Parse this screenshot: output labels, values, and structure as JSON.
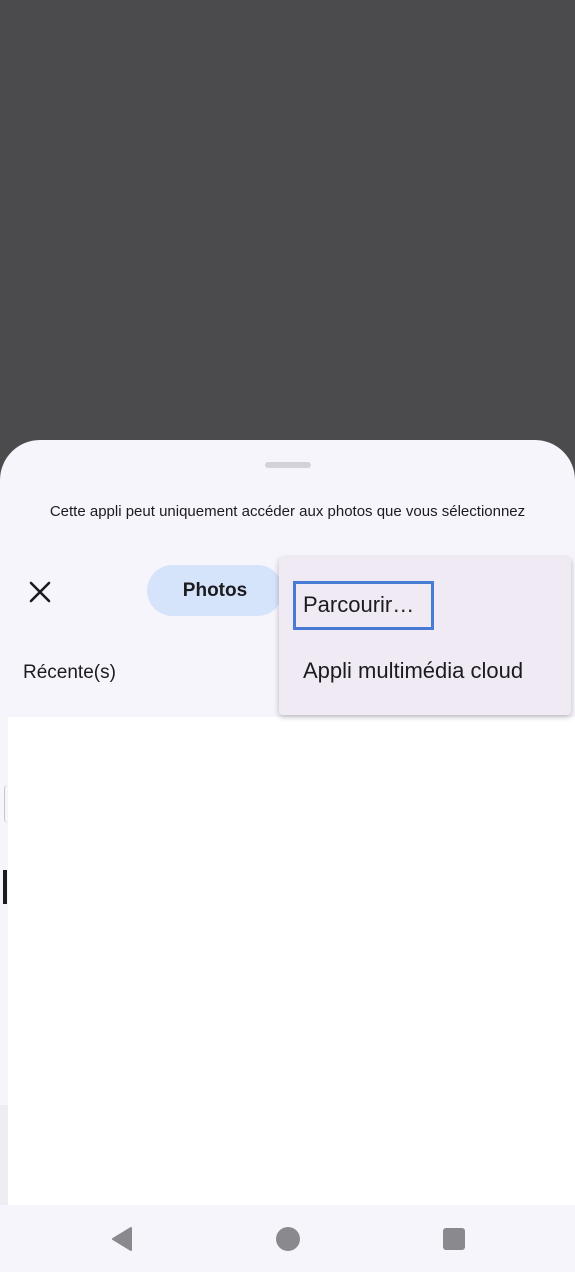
{
  "sheet": {
    "notice": "Cette appli peut uniquement accéder aux photos que vous sélectionnez",
    "tab_label": "Photos",
    "section_title": "Récente(s)"
  },
  "menu": {
    "items": [
      "Parcourir…",
      "Appli multimédia cloud"
    ],
    "focused_index": 0
  },
  "icons": {
    "close": "close-icon",
    "back": "back-icon",
    "home": "home-icon",
    "recents": "recents-icon"
  },
  "colors": {
    "scrim": "#4b4b4d",
    "sheet": "#f7f5fc",
    "tab_selected": "#d5e3fb",
    "menu": "#efeaf4",
    "focus": "#4a7bd4",
    "nav_icon": "#8a898d"
  }
}
